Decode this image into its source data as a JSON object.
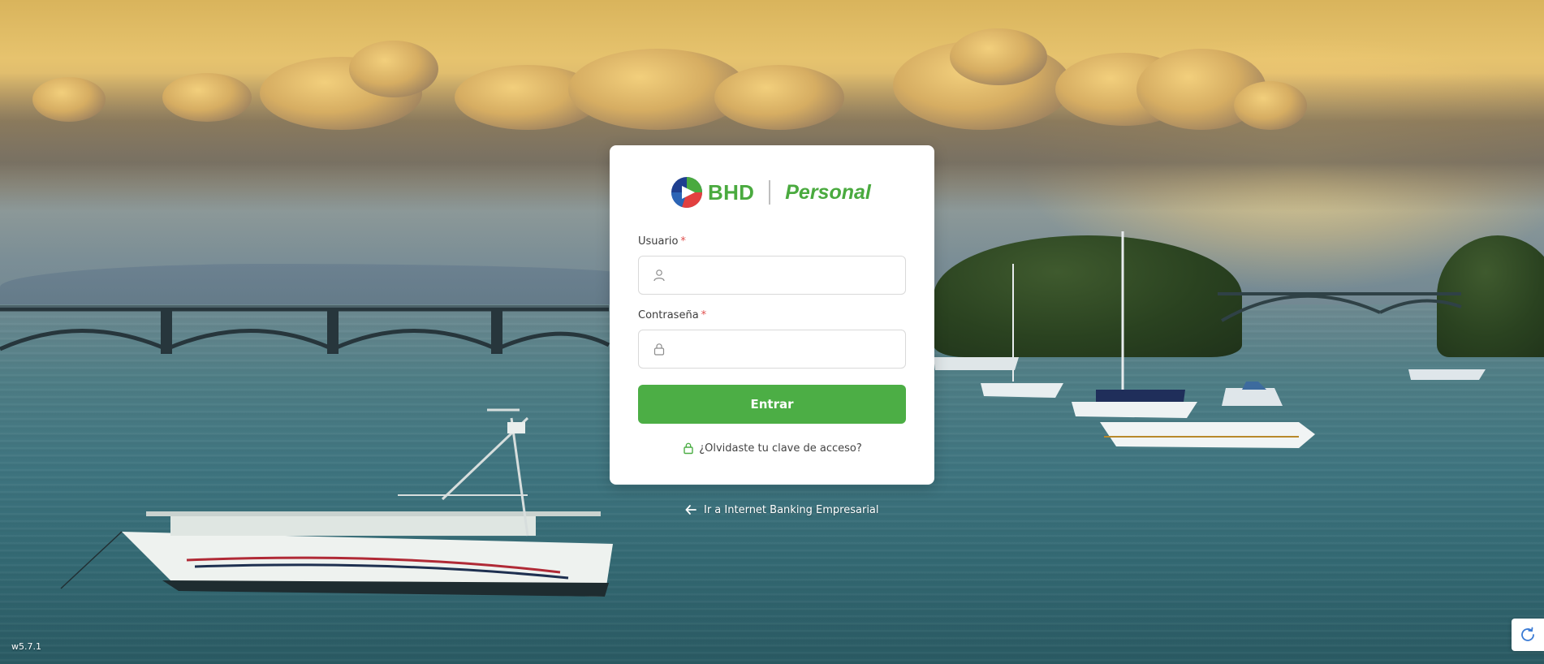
{
  "app": {
    "brand_name": "BHD",
    "product_name": "Personal",
    "accent_color": "#4cae45"
  },
  "login_form": {
    "username_label": "Usuario",
    "username_required_marker": "*",
    "username_value": "",
    "username_icon": "user-icon",
    "password_label": "Contraseña",
    "password_required_marker": "*",
    "password_value": "",
    "password_icon": "lock-icon",
    "submit_label": "Entrar",
    "forgot_password_label": "¿Olvidaste tu clave de acceso?",
    "forgot_password_icon": "lock-icon"
  },
  "footer": {
    "business_link_label": "Ir a Internet Banking Empresarial",
    "business_link_icon": "arrow-left-icon",
    "version": "w5.7.1",
    "refresh_icon": "refresh-icon"
  }
}
